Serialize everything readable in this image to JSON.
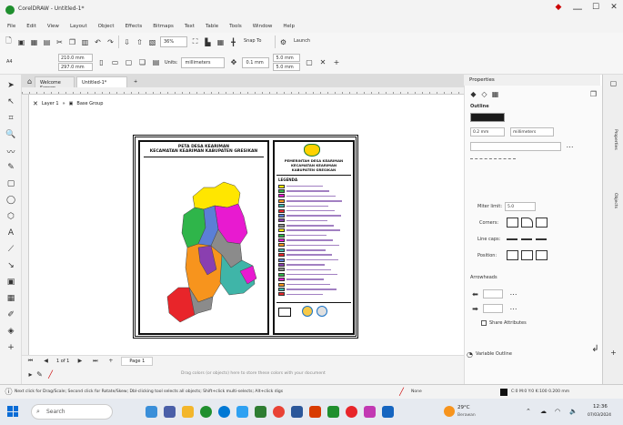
{
  "window": {
    "title": "CorelDRAW - Untitled-1*",
    "minimize": "—",
    "maximize": "☐",
    "close": "✕"
  },
  "menu": [
    "File",
    "Edit",
    "View",
    "Layout",
    "Object",
    "Effects",
    "Bitmaps",
    "Text",
    "Table",
    "Tools",
    "Window",
    "Help"
  ],
  "toolbar": {
    "zoom": "36%",
    "snap_to": "Snap To",
    "launch": "Launch"
  },
  "property_bar": {
    "page_size": "A4",
    "width": "210.0 mm",
    "height": "297.0 mm",
    "units_label": "Units:",
    "units": "millimeters",
    "nudge": "0.1 mm",
    "dup_x": "5.0 mm",
    "dup_y": "5.0 mm"
  },
  "doc_tabs": {
    "welcome": "Welcome Screen",
    "untitled": "Untitled-1*",
    "add": "+"
  },
  "breadcrumb": {
    "layer": "Layer 1",
    "group": "Base Group"
  },
  "map": {
    "title_line1": "PETA DESA KEARIMAN",
    "title_line2": "KECAMATAN KEARIMAN KABUPATEN GRESIKAN",
    "legend_heading": "PEMERINTAH DESA KEARIMAN",
    "legend_sub1": "KECAMATAN KEARIMAN",
    "legend_sub2": "KABUPATEN GRESIKAN",
    "legend_title": "LEGENDA",
    "colors": {
      "yellow": "#ffe600",
      "green": "#2fb54a",
      "magenta": "#e81ad0",
      "orange": "#f7941d",
      "teal": "#3fb5a8",
      "red": "#e8252a",
      "blue": "#5b7fd6",
      "purple": "#8a3fb0",
      "gray": "#8b8b8b"
    }
  },
  "pagebar": {
    "page_count": "1 of 1",
    "page_tab": "Page 1"
  },
  "hint": "Drag colors (or objects) here to store these colors with your document",
  "properties": {
    "title": "Properties",
    "section": "Outline",
    "width": "0.2 mm",
    "units": "millimeters",
    "miter_limit_label": "Miter limit:",
    "miter_limit": "5.0",
    "corners_label": "Corners:",
    "line_caps_label": "Line caps:",
    "position_label": "Position:",
    "arrowheads_label": "Arrowheads",
    "share_attributes": "Share Attributes",
    "variable_outline": "Variable Outline"
  },
  "side_tabs": [
    "Properties",
    "Objects"
  ],
  "status": {
    "hint": "Next click for Drag/Scale; Second click for Rotate/Skew; Dbl-clicking tool selects all objects; Shift+click multi-selects; Alt+click digs",
    "fill": "None",
    "outline": "C:0 M:0 Y:0 K:100  0.200 mm"
  },
  "taskbar": {
    "search": "Search",
    "weather": "29°C",
    "weather_sub": "Berawan",
    "time": "12:36",
    "date": "07/03/2024"
  }
}
